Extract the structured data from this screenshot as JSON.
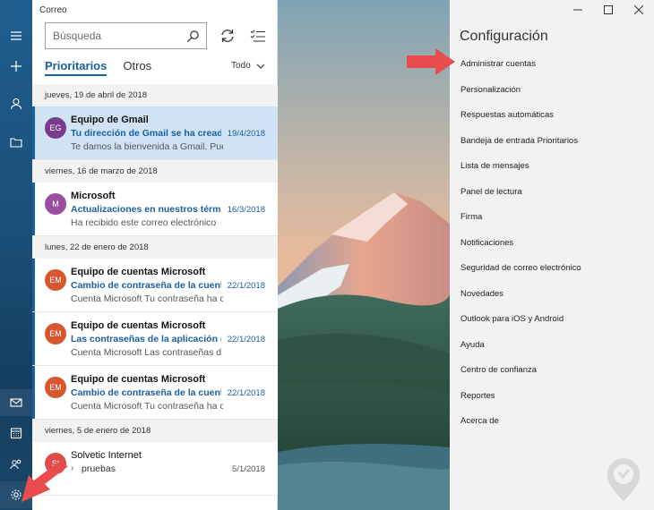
{
  "app": {
    "title": "Correo"
  },
  "search": {
    "placeholder": "Búsqueda"
  },
  "tabs": {
    "focused": "Prioritarios",
    "other": "Otros"
  },
  "filter": {
    "label": "Todo"
  },
  "groups": [
    {
      "date": "jueves, 19 de abril de 2018",
      "messages": [
        {
          "initials": "EG",
          "avatar_color": "#7a3b8f",
          "sender": "Equipo de Gmail",
          "subject": "Tu dirección de Gmail se ha creado",
          "date": "19/4/2018",
          "preview": "Te damos la bienvenida a Gmail. Pue"
        }
      ]
    },
    {
      "date": "viernes, 16 de marzo de 2018",
      "messages": [
        {
          "initials": "M",
          "avatar_color": "#9a4f9e",
          "sender": "Microsoft",
          "subject": "Actualizaciones en nuestros términ",
          "date": "16/3/2018",
          "preview": "Ha recibido este correo electrónico"
        }
      ]
    },
    {
      "date": "lunes, 22 de enero de 2018",
      "messages": [
        {
          "initials": "EM",
          "avatar_color": "#d9562f",
          "sender": "Equipo de cuentas Microsoft",
          "subject": "Cambio de contraseña de la cuenta",
          "date": "22/1/2018",
          "preview": "Cuenta Microsoft Tu contraseña ha c"
        },
        {
          "initials": "EM",
          "avatar_color": "#d9562f",
          "sender": "Equipo de cuentas Microsoft",
          "subject": "Las contraseñas de la aplicación de",
          "date": "22/1/2018",
          "preview": "Cuenta Microsoft Las contraseñas d"
        },
        {
          "initials": "EM",
          "avatar_color": "#d9562f",
          "sender": "Equipo de cuentas Microsoft",
          "subject": "Cambio de contraseña de la cuenta",
          "date": "22/1/2018",
          "preview": "Cuenta Microsoft Tu contraseña ha c"
        }
      ]
    },
    {
      "date": "viernes, 5 de enero de 2018",
      "messages": [
        {
          "initials": "SI",
          "avatar_color": "#e04b4b",
          "sender": "Solvetic Internet",
          "subject": "pruebas",
          "date": "5/1/2018"
        }
      ]
    }
  ],
  "settings": {
    "title": "Configuración",
    "items": [
      "Administrar cuentas",
      "Personalización",
      "Respuestas automáticas",
      "Bandeja de entrada Prioritarios",
      "Lista de mensajes",
      "Panel de lectura",
      "Firma",
      "Notificaciones",
      "Seguridad de correo electrónico",
      "Novedades",
      "Outlook para iOS y Android",
      "Ayuda",
      "Centro de confianza",
      "Reportes",
      "Acerca de"
    ]
  },
  "icons": {
    "rail": [
      "hamburger-icon",
      "compose-icon",
      "account-icon",
      "folder-icon",
      "mail-icon",
      "calendar-icon",
      "people-icon",
      "settings-icon"
    ],
    "annotation_color": "#e84c4c"
  }
}
